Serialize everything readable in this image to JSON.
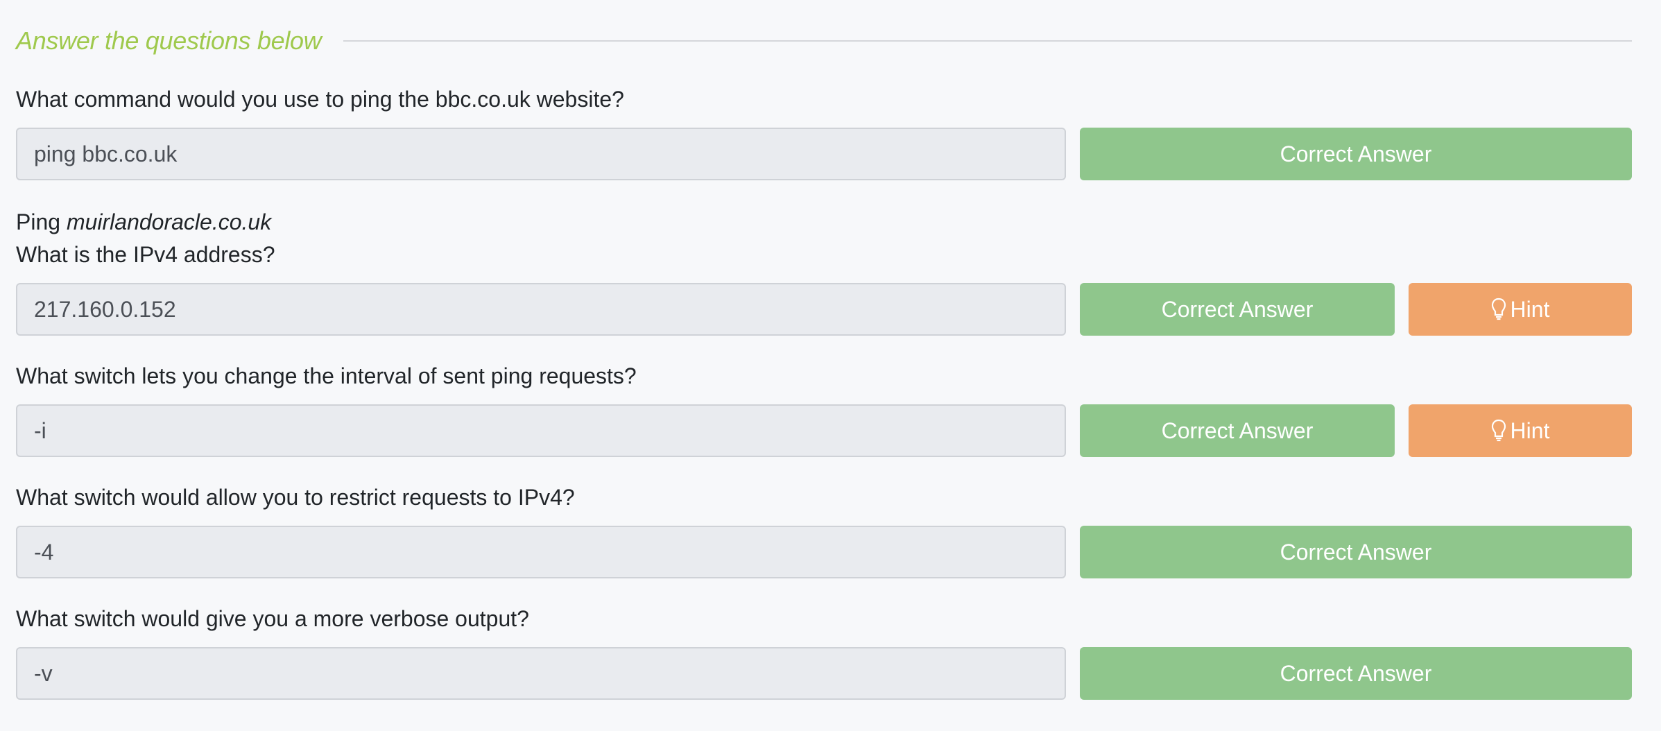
{
  "section": {
    "title": "Answer the questions below"
  },
  "questions": [
    {
      "text": "What command would you use to ping the bbc.co.uk website?",
      "answer": "ping bbc.co.uk",
      "status": "Correct Answer"
    },
    {
      "text_prefix": "Ping ",
      "text_emphasis": "muirlandoracle.co.uk",
      "text_line2": "What is the IPv4 address?",
      "answer": "217.160.0.152",
      "status": "Correct Answer",
      "hint": "Hint"
    },
    {
      "text": "What switch lets you change the interval of sent ping requests?",
      "answer": "-i",
      "status": "Correct Answer",
      "hint": "Hint"
    },
    {
      "text": "What switch would allow you to restrict requests to IPv4?",
      "answer": "-4",
      "status": "Correct Answer"
    },
    {
      "text": "What switch would give you a more verbose output?",
      "answer": "-v",
      "status": "Correct Answer"
    }
  ],
  "colors": {
    "accent": "#9fc94d",
    "correct": "#8fc68c",
    "hint": "#f0a46b"
  },
  "icons": {
    "hint": "lightbulb-icon"
  }
}
